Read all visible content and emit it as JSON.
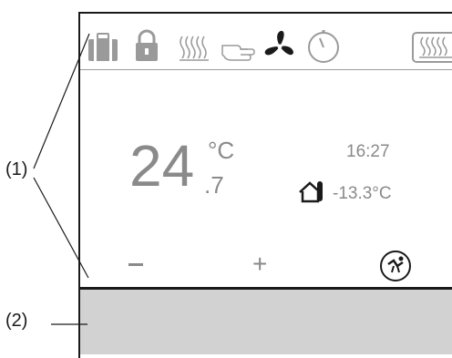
{
  "callouts": {
    "status_icons": "(1)",
    "bottom_bar": "(2)"
  },
  "display": {
    "temperature_integer": "24",
    "temperature_decimal": ".7",
    "temperature_unit": "°C",
    "time": "16:27",
    "outdoor_temperature": "-13.3°C",
    "minus_label": "−",
    "plus_label": "+"
  },
  "icons": [
    "suitcase-icon",
    "lock-icon",
    "heating-waves-icon",
    "hand-icon",
    "fan-icon",
    "timer-icon",
    "heating-panel-icon",
    "outdoor-house-icon",
    "eco-mode-icon"
  ],
  "colors": {
    "text_gray": "#8a8a8a",
    "icon_gray": "#9a9a9a",
    "frame_black": "#1a1a1a",
    "bar_gray": "#d2d2d2"
  }
}
